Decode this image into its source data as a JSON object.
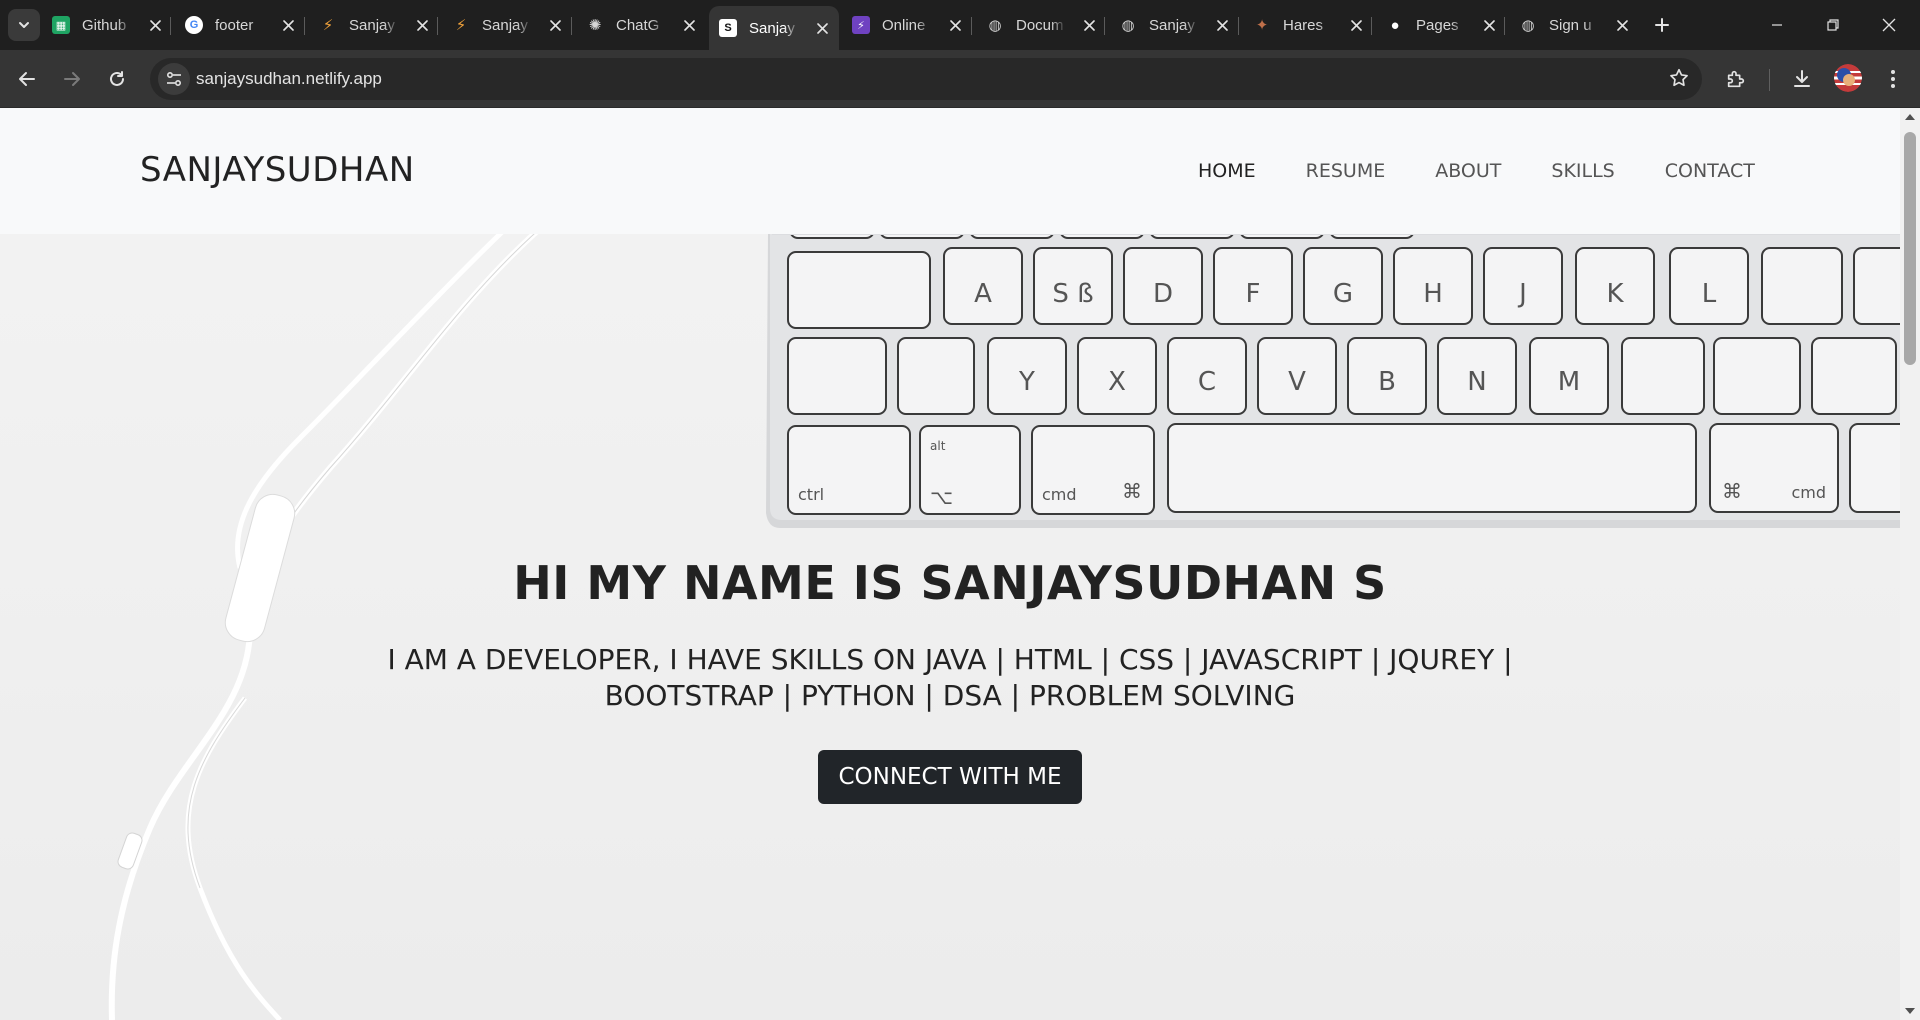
{
  "browser": {
    "tabs": [
      {
        "title": "Github",
        "favicon": "sheets-icon",
        "color": "#1fa463"
      },
      {
        "title": "footer",
        "favicon": "google-icon",
        "color": "#4285f4"
      },
      {
        "title": "Sanjay",
        "favicon": "site-icon",
        "color": "#f0a23b"
      },
      {
        "title": "Sanjay",
        "favicon": "site-icon",
        "color": "#f0a23b"
      },
      {
        "title": "ChatG",
        "favicon": "chatgpt-icon",
        "color": "#d7d7d7"
      },
      {
        "title": "Sanjay",
        "favicon": "s-icon",
        "color": "#ffffff",
        "active": true
      },
      {
        "title": "Online",
        "favicon": "bolt-icon",
        "color": "#6f42c1"
      },
      {
        "title": "Docum",
        "favicon": "globe-icon",
        "color": "#cfcfcf"
      },
      {
        "title": "Sanjay",
        "favicon": "globe-icon",
        "color": "#cfcfcf"
      },
      {
        "title": "Hares",
        "favicon": "person-icon",
        "color": "#c0704a"
      },
      {
        "title": "Pages",
        "favicon": "github-icon",
        "color": "#ffffff"
      },
      {
        "title": "Sign u",
        "favicon": "globe-icon",
        "color": "#cfcfcf"
      }
    ],
    "url": "sanjaysudhan.netlify.app"
  },
  "site": {
    "brand": "SANJAYSUDHAN",
    "nav": [
      "HOME",
      "RESUME",
      "ABOUT",
      "SKILLS",
      "CONTACT"
    ],
    "hero_title": "HI MY NAME IS SANJAYSUDHAN S",
    "hero_subtitle": "I AM A DEVELOPER, I HAVE SKILLS ON JAVA | HTML | CSS | JAVASCRIPT | JQUREY | BOOTSTRAP | PYTHON | DSA | PROBLEM SOLVING",
    "cta_label": "CONNECT WITH ME"
  },
  "keyboard_keys": {
    "row1": [
      "A",
      "S ß",
      "D",
      "F",
      "G",
      "H",
      "J",
      "K",
      "L"
    ],
    "row2": [
      "Y",
      "X",
      "C",
      "V",
      "B",
      "N",
      "M"
    ],
    "ctrl": "ctrl",
    "alt": "alt",
    "alt_symbol": "⌥",
    "cmd": "cmd",
    "cmd_symbol": "⌘"
  },
  "colors": {
    "tabstrip": "#1f1f1f",
    "toolbar": "#353535",
    "nav_bg": "#f8f9fa",
    "cta_bg": "#212529",
    "text": "#222222"
  }
}
